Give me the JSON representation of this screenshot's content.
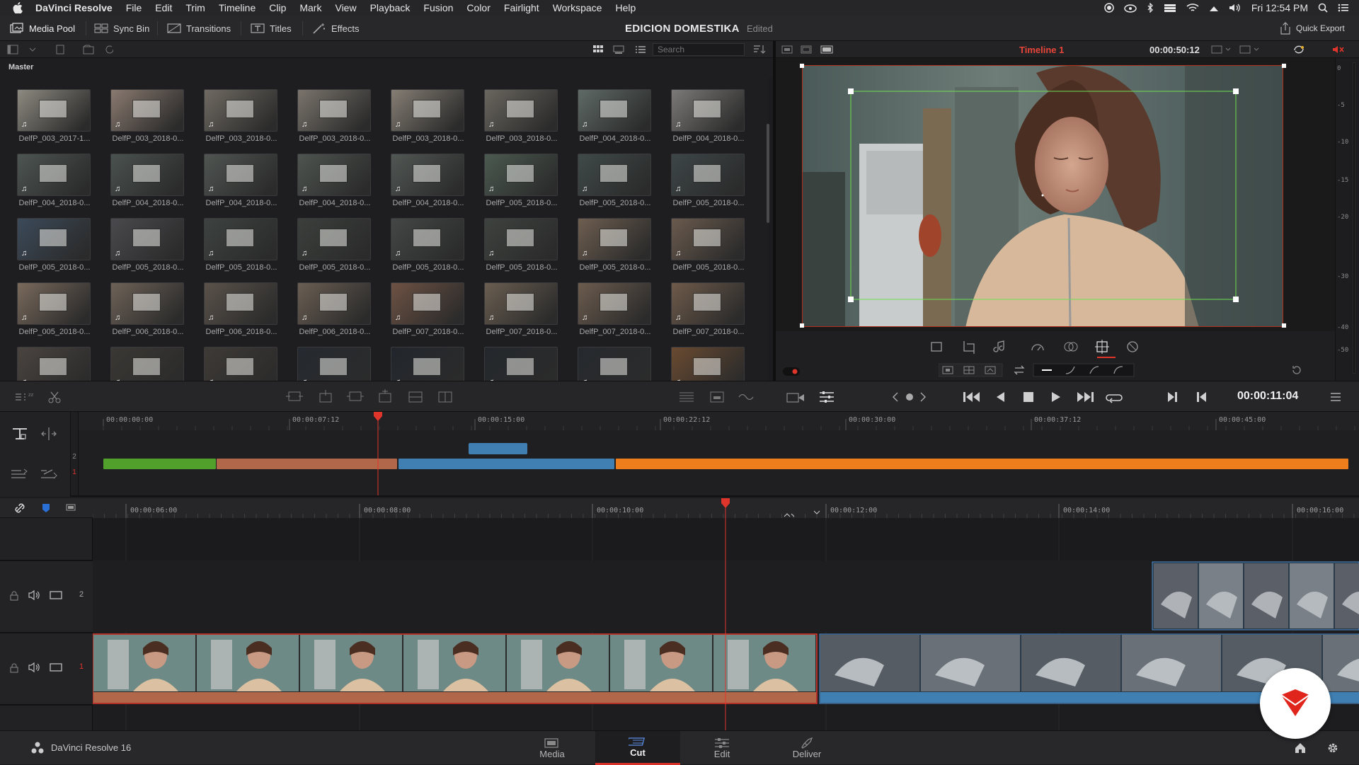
{
  "menubar": {
    "app_name": "DaVinci Resolve",
    "items": [
      "File",
      "Edit",
      "Trim",
      "Timeline",
      "Clip",
      "Mark",
      "View",
      "Playback",
      "Fusion",
      "Color",
      "Fairlight",
      "Workspace",
      "Help"
    ],
    "clock": "Fri 12:54 PM"
  },
  "toolbar": {
    "media_pool": "Media Pool",
    "sync_bin": "Sync Bin",
    "transitions": "Transitions",
    "titles": "Titles",
    "effects": "Effects",
    "project_title": "EDICION DOMESTIKA",
    "project_status": "Edited",
    "quick_export": "Quick Export"
  },
  "media_pool": {
    "search_placeholder": "Search",
    "bin_name": "Master",
    "clips": [
      {
        "name": "DelfP_003_2017-1...",
        "tone": "#8d8a80"
      },
      {
        "name": "DelfP_003_2018-0...",
        "tone": "#8a7a70"
      },
      {
        "name": "DelfP_003_2018-0...",
        "tone": "#6f6a62"
      },
      {
        "name": "DelfP_003_2018-0...",
        "tone": "#7a746c"
      },
      {
        "name": "DelfP_003_2018-0...",
        "tone": "#857e74"
      },
      {
        "name": "DelfP_003_2018-0...",
        "tone": "#6a665f"
      },
      {
        "name": "DelfP_004_2018-0...",
        "tone": "#5f6a66"
      },
      {
        "name": "DelfP_004_2018-0...",
        "tone": "#7c7a78"
      },
      {
        "name": "DelfP_004_2018-0...",
        "tone": "#4d5552"
      },
      {
        "name": "DelfP_004_2018-0...",
        "tone": "#4a524f"
      },
      {
        "name": "DelfP_004_2018-0...",
        "tone": "#505552"
      },
      {
        "name": "DelfP_004_2018-0...",
        "tone": "#4e5450"
      },
      {
        "name": "DelfP_004_2018-0...",
        "tone": "#515754"
      },
      {
        "name": "DelfP_005_2018-0...",
        "tone": "#4b5a50"
      },
      {
        "name": "DelfP_005_2018-0...",
        "tone": "#3f4a48"
      },
      {
        "name": "DelfP_005_2018-0...",
        "tone": "#3d4648"
      },
      {
        "name": "DelfP_005_2018-0...",
        "tone": "#3c4a5a"
      },
      {
        "name": "DelfP_005_2018-0...",
        "tone": "#4a4a4e"
      },
      {
        "name": "DelfP_005_2018-0...",
        "tone": "#3d4240"
      },
      {
        "name": "DelfP_005_2018-0...",
        "tone": "#3b3f3c"
      },
      {
        "name": "DelfP_005_2018-0...",
        "tone": "#434745"
      },
      {
        "name": "DelfP_005_2018-0...",
        "tone": "#3e423f"
      },
      {
        "name": "DelfP_005_2018-0...",
        "tone": "#6e5e50"
      },
      {
        "name": "DelfP_005_2018-0...",
        "tone": "#6a5a4d"
      },
      {
        "name": "DelfP_005_2018-0...",
        "tone": "#7a6a5c"
      },
      {
        "name": "DelfP_006_2018-0...",
        "tone": "#6e6257"
      },
      {
        "name": "DelfP_006_2018-0...",
        "tone": "#5a524a"
      },
      {
        "name": "DelfP_006_2018-0...",
        "tone": "#6a5e52"
      },
      {
        "name": "DelfP_007_2018-0...",
        "tone": "#6e5244"
      },
      {
        "name": "DelfP_007_2018-0...",
        "tone": "#6a5e50"
      },
      {
        "name": "DelfP_007_2018-0...",
        "tone": "#6c5c4e"
      },
      {
        "name": "DelfP_007_2018-0...",
        "tone": "#6e5a4a"
      },
      {
        "name": "",
        "tone": "#4a4440"
      },
      {
        "name": "",
        "tone": "#3a3834"
      },
      {
        "name": "",
        "tone": "#3e3a36"
      },
      {
        "name": "",
        "tone": "#252a30"
      },
      {
        "name": "",
        "tone": "#22262c"
      },
      {
        "name": "",
        "tone": "#24282c"
      },
      {
        "name": "",
        "tone": "#262a2e"
      },
      {
        "name": "",
        "tone": "#6a4a30"
      }
    ]
  },
  "viewer": {
    "timeline_name": "Timeline 1",
    "source_timecode": "00:00:50:12",
    "meter_labels": [
      "0",
      "-5",
      "-10",
      "-15",
      "-20",
      "-30",
      "-40",
      "-50"
    ]
  },
  "transport": {
    "timecode": "00:00:11:04"
  },
  "upper_timeline": {
    "ruler_labels": [
      "00:00:00:00",
      "00:00:07:12",
      "00:00:15:00",
      "00:00:22:12",
      "00:00:30:00",
      "00:00:37:12",
      "00:00:45:00"
    ],
    "track_numbers": [
      "2",
      "1"
    ],
    "colors": {
      "green": "#52a02c",
      "salmon": "#b0674a",
      "blue": "#3f7fb2",
      "orange": "#ee7d1c",
      "playhead": "#e0352b"
    }
  },
  "lower_timeline": {
    "ruler_labels": [
      "00:00:06:00",
      "00:00:08:00",
      "00:00:10:00",
      "00:00:12:00",
      "00:00:14:00",
      "00:00:16:00"
    ],
    "track_v2": "2",
    "track_v1": "1"
  },
  "footer": {
    "app_version": "DaVinci Resolve 16",
    "pages": [
      {
        "label": "Media",
        "icon": "media-page-icon"
      },
      {
        "label": "Cut",
        "icon": "cut-page-icon"
      },
      {
        "label": "Edit",
        "icon": "edit-page-icon"
      },
      {
        "label": "Deliver",
        "icon": "deliver-page-icon"
      }
    ],
    "active_page": "Cut"
  }
}
